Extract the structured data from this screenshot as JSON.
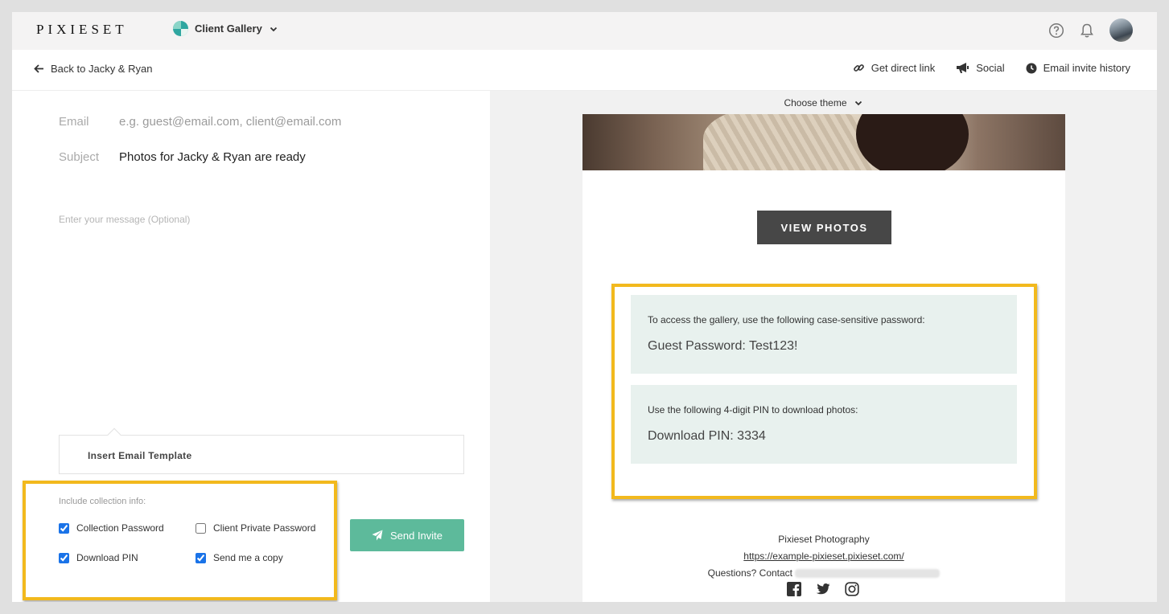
{
  "topbar": {
    "logo": "PIXIESET",
    "product": "Client Gallery"
  },
  "subbar": {
    "back": "Back to Jacky & Ryan",
    "actions": [
      "Get direct link",
      "Social",
      "Email invite history"
    ]
  },
  "form": {
    "email_label": "Email",
    "email_placeholder": "e.g. guest@email.com, client@email.com",
    "subject_label": "Subject",
    "subject_value": "Photos for Jacky & Ryan are ready",
    "message_placeholder": "Enter your message (Optional)",
    "template_button": "Insert Email Template",
    "include_title": "Include collection info:",
    "options": [
      {
        "label": "Collection Password",
        "checked": true
      },
      {
        "label": "Client Private Password",
        "checked": false
      },
      {
        "label": "Download PIN",
        "checked": true
      },
      {
        "label": "Send me a copy",
        "checked": true
      }
    ],
    "send_button": "Send Invite"
  },
  "preview": {
    "theme_label": "Choose theme",
    "view_button": "VIEW PHOTOS",
    "password_note": "To access the gallery, use the following case-sensitive password:",
    "password_line": "Guest Password: Test123!",
    "pin_note": "Use the following 4-digit PIN to download photos:",
    "pin_line": "Download PIN: 3334",
    "studio": "Pixieset Photography",
    "url": "https://example-pixieset.pixieset.com/",
    "contact": "Questions? Contact"
  },
  "colors": {
    "accent_green": "#5dba9b",
    "highlight_yellow": "#f2b91d",
    "info_panel": "#e8f1ee"
  }
}
